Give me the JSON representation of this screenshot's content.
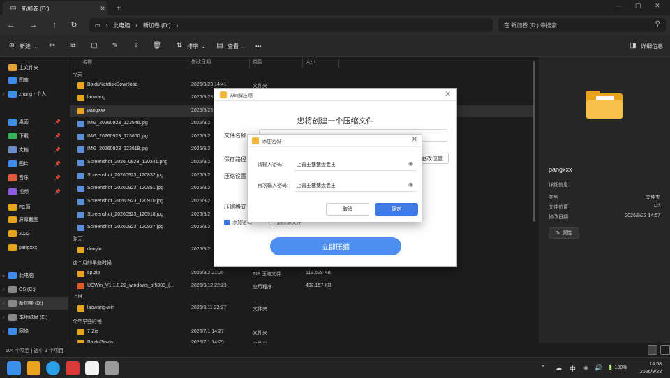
{
  "window": {
    "tab_title": "新加卷 (D:)",
    "tab_close": "✕",
    "tab_add": "+",
    "controls": [
      "—",
      "▢",
      "✕"
    ]
  },
  "nav": {
    "back": "←",
    "forward": "→",
    "up": "↑",
    "refresh": "↻",
    "breadcrumb": [
      "此电脑",
      "新加卷 (D:)"
    ],
    "search_placeholder": "在 新加卷 (D:) 中搜索"
  },
  "toolbar": {
    "new_label": "新建",
    "sort_label": "排序",
    "view_label": "查看",
    "more_label": "•••",
    "details_label": "详细信息"
  },
  "sidebar": {
    "items": [
      {
        "label": "主文件夹",
        "color": "#e8a23a",
        "chev": "",
        "pin": ""
      },
      {
        "label": "图库",
        "color": "#3c8ee8",
        "chev": "",
        "pin": ""
      },
      {
        "label": "zhang - 个人",
        "color": "#3c8ee8",
        "chev": "›",
        "pin": ""
      },
      {
        "label": "桌面",
        "color": "#3c8ee8",
        "chev": "",
        "pin": "📌"
      },
      {
        "label": "下载",
        "color": "#37b25a",
        "chev": "",
        "pin": "📌"
      },
      {
        "label": "文档",
        "color": "#6b8cc7",
        "chev": "",
        "pin": "📌"
      },
      {
        "label": "图片",
        "color": "#3c8ee8",
        "chev": "",
        "pin": "📌"
      },
      {
        "label": "音乐",
        "color": "#e05a3a",
        "chev": "",
        "pin": "📌"
      },
      {
        "label": "视频",
        "color": "#8e5be0",
        "chev": "",
        "pin": "📌"
      },
      {
        "label": "FC源",
        "color": "#e9a41f",
        "chev": "",
        "pin": ""
      },
      {
        "label": "屏幕截图",
        "color": "#e9a41f",
        "chev": "",
        "pin": ""
      },
      {
        "label": "2022",
        "color": "#e9a41f",
        "chev": "",
        "pin": ""
      },
      {
        "label": "pangxxx",
        "color": "#e9a41f",
        "chev": "",
        "pin": ""
      },
      {
        "label": "此电脑",
        "color": "#3c8ee8",
        "chev": "⌄",
        "pin": ""
      },
      {
        "label": "OS (C:)",
        "color": "#888888",
        "chev": "›",
        "pin": ""
      },
      {
        "label": "新加卷 (D:)",
        "color": "#888888",
        "chev": "›",
        "pin": ""
      },
      {
        "label": "本地磁盘 (E:)",
        "color": "#888888",
        "chev": "›",
        "pin": ""
      },
      {
        "label": "网络",
        "color": "#3c8ee8",
        "chev": "›",
        "pin": ""
      }
    ]
  },
  "list": {
    "headers": [
      "名称",
      "修改日期",
      "类型",
      "大小"
    ],
    "groups": [
      "今天",
      "昨天",
      "这个月的早些时候",
      "上月",
      "今年早些时候"
    ],
    "rows": [
      {
        "name": "BaiduNetdiskDownload",
        "date": "2026/9/23 14:41",
        "type": "文件夹",
        "size": "",
        "color": "#e9a41f"
      },
      {
        "name": "laowang",
        "date": "2026/9/23",
        "type": "",
        "size": "",
        "color": "#e9a41f"
      },
      {
        "name": "pangxxx",
        "date": "2026/9/23",
        "type": "",
        "size": "",
        "color": "#e9a41f"
      },
      {
        "name": "IMG_20260923_123546.jpg",
        "date": "2026/9/2",
        "type": "",
        "size": "",
        "color": "#5a8fd8"
      },
      {
        "name": "IMG_20260923_123600.jpg",
        "date": "2026/9/2",
        "type": "",
        "size": "",
        "color": "#5a8fd8"
      },
      {
        "name": "IMG_20260923_123618.jpg",
        "date": "2026/9/2",
        "type": "",
        "size": "",
        "color": "#5a8fd8"
      },
      {
        "name": "Screenshot_2026_0923_120341.png",
        "date": "2026/9/2",
        "type": "",
        "size": "",
        "color": "#5a8fd8"
      },
      {
        "name": "Screenshot_20260923_120832.jpg",
        "date": "2026/9/2",
        "type": "",
        "size": "",
        "color": "#5a8fd8"
      },
      {
        "name": "Screenshot_20260923_120851.jpg",
        "date": "2026/9/2",
        "type": "",
        "size": "",
        "color": "#5a8fd8"
      },
      {
        "name": "Screenshot_20260923_120910.jpg",
        "date": "2026/9/2",
        "type": "",
        "size": "",
        "color": "#5a8fd8"
      },
      {
        "name": "Screenshot_20260923_120918.jpg",
        "date": "2026/9/2",
        "type": "",
        "size": "",
        "color": "#5a8fd8"
      },
      {
        "name": "Screenshot_20260923_120927.jpg",
        "date": "2026/9/2",
        "type": "",
        "size": "",
        "color": "#5a8fd8"
      },
      {
        "name": "douyin",
        "date": "2026/9/2",
        "type": "",
        "size": "",
        "color": "#e9a41f"
      },
      {
        "name": "sp.zip",
        "date": "2026/9/2 21:26",
        "type": "ZIP 压缩文件",
        "size": "113,629 KB",
        "color": "#e9a41f"
      },
      {
        "name": "UCWin_V1.1.0.22_windows_pf5003_(...",
        "date": "2026/9/12 22:23",
        "type": "应用程序",
        "size": "432,157 KB",
        "color": "#e05a2a"
      },
      {
        "name": "laowang-win",
        "date": "2026/8/11 22:37",
        "type": "文件夹",
        "size": "",
        "color": "#e9a41f"
      },
      {
        "name": "7-Zip",
        "date": "2026/7/1 14:27",
        "type": "文件夹",
        "size": "",
        "color": "#e9a41f"
      },
      {
        "name": "BaiduPinyin",
        "date": "2026/7/1 14:29",
        "type": "文件夹",
        "size": "",
        "color": "#e9a41f"
      }
    ]
  },
  "details": {
    "name": "pangxxx",
    "header": "详细信息",
    "props": [
      {
        "k": "类型",
        "v": "文件夹"
      },
      {
        "k": "文件位置",
        "v": "D:\\"
      },
      {
        "k": "修改日期",
        "v": "2026/9/23 14:57"
      }
    ],
    "attr_label": "属性"
  },
  "status": {
    "text": "104 个项目  |  选中 1 个项目"
  },
  "compress_dialog": {
    "title": "Win解压缩",
    "heading": "您将创建一个压缩文件",
    "labels": [
      "文件名称",
      "保存路径",
      "压缩设置",
      "压缩格式"
    ],
    "change_location": "更改位置",
    "opt_password": "添加密码",
    "opt_delete": "删除源文件",
    "go_button": "立即压缩"
  },
  "password_dialog": {
    "title": "添加密码",
    "label1": "请输入密码:",
    "label2": "再次输入密码:",
    "value1": "上善王猪猪盘老王",
    "value2": "上善王猪猪盘老王",
    "cancel": "取消",
    "ok": "确定"
  },
  "taskbar": {
    "tray": [
      "^",
      "☁",
      "中",
      "◈",
      "🔊",
      "🔋 100%"
    ],
    "time": "14:58",
    "date": "2026/9/23"
  }
}
